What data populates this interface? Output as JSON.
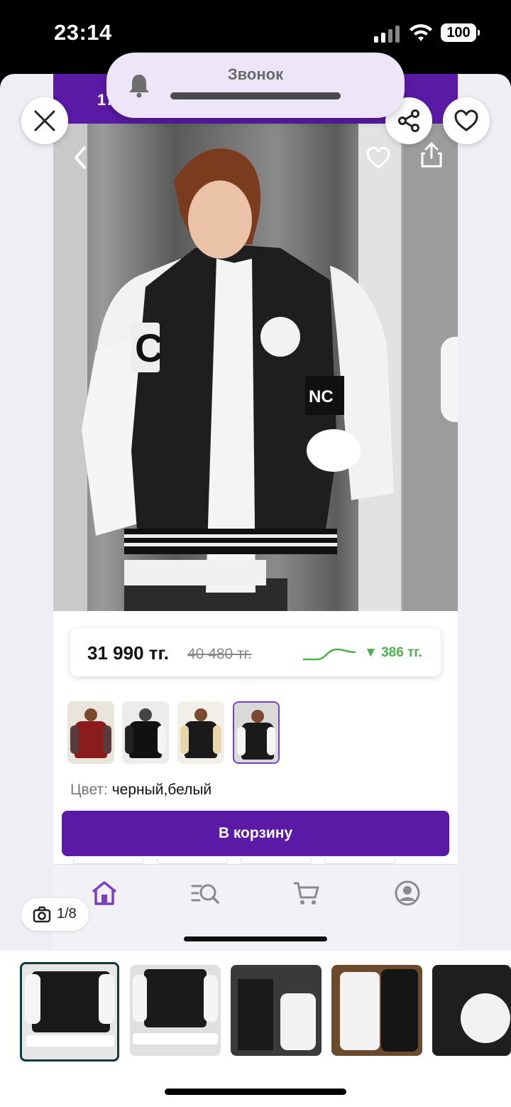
{
  "status_bar": {
    "time": "23:14",
    "battery": "100"
  },
  "call_banner": {
    "title": "Звонок"
  },
  "header": {
    "promo_number": "17"
  },
  "product": {
    "price_current": "31 990 тг.",
    "price_old": "40 480 тг.",
    "price_drop": "▼ 386 тг.",
    "color_label": "Цвет:",
    "color_value": "черный,белый",
    "cart_button": "В корзину"
  },
  "gallery": {
    "counter": "1/8"
  },
  "tabs": [
    {
      "name": "home-icon",
      "active": true
    },
    {
      "name": "catalog-search-icon",
      "active": false
    },
    {
      "name": "cart-icon",
      "active": false
    },
    {
      "name": "profile-icon",
      "active": false
    }
  ],
  "colors": {
    "accent": "#5a1aa6",
    "price_drop": "#4caf50",
    "tab_active": "#7b3fc4"
  },
  "icons": [
    "close-icon",
    "share-icon",
    "heart-icon",
    "bell-icon",
    "chevron-left-icon",
    "upload-icon",
    "camera-icon"
  ]
}
